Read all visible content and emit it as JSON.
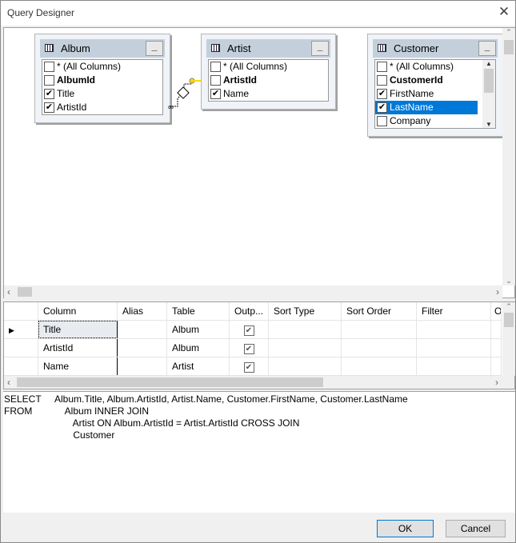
{
  "window": {
    "title": "Query Designer",
    "close": "✕"
  },
  "tables": [
    {
      "name": "Album",
      "minimize": "_",
      "columns": [
        {
          "label": "* (All Columns)",
          "checked": false,
          "key": false
        },
        {
          "label": "AlbumId",
          "checked": false,
          "key": true
        },
        {
          "label": "Title",
          "checked": true,
          "key": false
        },
        {
          "label": "ArtistId",
          "checked": true,
          "key": false
        }
      ]
    },
    {
      "name": "Artist",
      "minimize": "_",
      "columns": [
        {
          "label": "* (All Columns)",
          "checked": false,
          "key": false
        },
        {
          "label": "ArtistId",
          "checked": false,
          "key": true
        },
        {
          "label": "Name",
          "checked": true,
          "key": false
        }
      ]
    },
    {
      "name": "Customer",
      "minimize": "_",
      "columns": [
        {
          "label": "* (All Columns)",
          "checked": false,
          "key": false
        },
        {
          "label": "CustomerId",
          "checked": false,
          "key": true
        },
        {
          "label": "FirstName",
          "checked": true,
          "key": false
        },
        {
          "label": "LastName",
          "checked": true,
          "key": false,
          "selected": true
        },
        {
          "label": "Company",
          "checked": false,
          "key": false
        }
      ]
    }
  ],
  "grid": {
    "headers": [
      "Column",
      "Alias",
      "Table",
      "Outp...",
      "Sort Type",
      "Sort Order",
      "Filter",
      "O"
    ],
    "rows": [
      {
        "column": "Title",
        "alias": "",
        "table": "Album",
        "output": true
      },
      {
        "column": "ArtistId",
        "alias": "",
        "table": "Album",
        "output": true
      },
      {
        "column": "Name",
        "alias": "",
        "table": "Artist",
        "output": true
      }
    ]
  },
  "sql": {
    "lines": [
      {
        "kw": "SELECT",
        "text": "Album.Title, Album.ArtistId, Artist.Name, Customer.FirstName, Customer.LastName"
      },
      {
        "kw": "FROM",
        "text": "    Album INNER JOIN"
      },
      {
        "kw": "",
        "text": "       Artist ON Album.ArtistId = Artist.ArtistId CROSS JOIN"
      },
      {
        "kw": "",
        "text": "       Customer"
      }
    ]
  },
  "buttons": {
    "ok": "OK",
    "cancel": "Cancel"
  },
  "check_glyph": "✔"
}
